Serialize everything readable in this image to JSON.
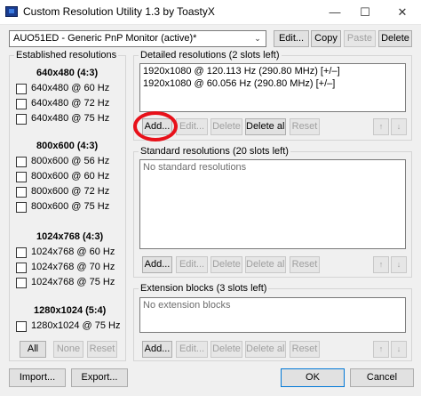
{
  "window": {
    "title": "Custom Resolution Utility 1.3 by ToastyX",
    "minimize": "—",
    "maximize": "☐",
    "close": "✕"
  },
  "monitor": {
    "selected": "AUO51ED - Generic PnP Monitor (active)*",
    "arrow": "⌄",
    "edit_label": "Edit...",
    "copy_label": "Copy",
    "paste_label": "Paste",
    "delete_label": "Delete"
  },
  "established": {
    "label": "Established resolutions",
    "groups": [
      {
        "heading": "640x480 (4:3)",
        "items": [
          "640x480 @ 60 Hz",
          "640x480 @ 72 Hz",
          "640x480 @ 75 Hz"
        ]
      },
      {
        "heading": "800x600 (4:3)",
        "items": [
          "800x600 @ 56 Hz",
          "800x600 @ 60 Hz",
          "800x600 @ 72 Hz",
          "800x600 @ 75 Hz"
        ]
      },
      {
        "heading": "1024x768 (4:3)",
        "items": [
          "1024x768 @ 60 Hz",
          "1024x768 @ 70 Hz",
          "1024x768 @ 75 Hz"
        ]
      },
      {
        "heading": "1280x1024 (5:4)",
        "items": [
          "1280x1024 @ 75 Hz"
        ]
      }
    ],
    "all_label": "All",
    "none_label": "None",
    "reset_label": "Reset"
  },
  "detailed": {
    "label": "Detailed resolutions (2 slots left)",
    "items": [
      "1920x1080 @ 120.113 Hz (290.80 MHz) [+/–]",
      "1920x1080 @ 60.056 Hz (290.80 MHz) [+/–]"
    ],
    "add_label": "Add...",
    "edit_label": "Edit...",
    "delete_label": "Delete",
    "delete_all_label": "Delete all",
    "reset_label": "Reset",
    "up_label": "↑",
    "down_label": "↓"
  },
  "standard": {
    "label": "Standard resolutions (20 slots left)",
    "empty_text": "No standard resolutions",
    "add_label": "Add...",
    "edit_label": "Edit...",
    "delete_label": "Delete",
    "delete_all_label": "Delete all",
    "reset_label": "Reset",
    "up_label": "↑",
    "down_label": "↓"
  },
  "extension": {
    "label": "Extension blocks (3 slots left)",
    "empty_text": "No extension blocks",
    "add_label": "Add...",
    "edit_label": "Edit...",
    "delete_label": "Delete",
    "delete_all_label": "Delete all",
    "reset_label": "Reset",
    "up_label": "↑",
    "down_label": "↓"
  },
  "footer": {
    "import_label": "Import...",
    "export_label": "Export...",
    "ok_label": "OK",
    "cancel_label": "Cancel"
  },
  "colors": {
    "highlight_circle": "#e8111a",
    "focus_border": "#0078d7"
  }
}
